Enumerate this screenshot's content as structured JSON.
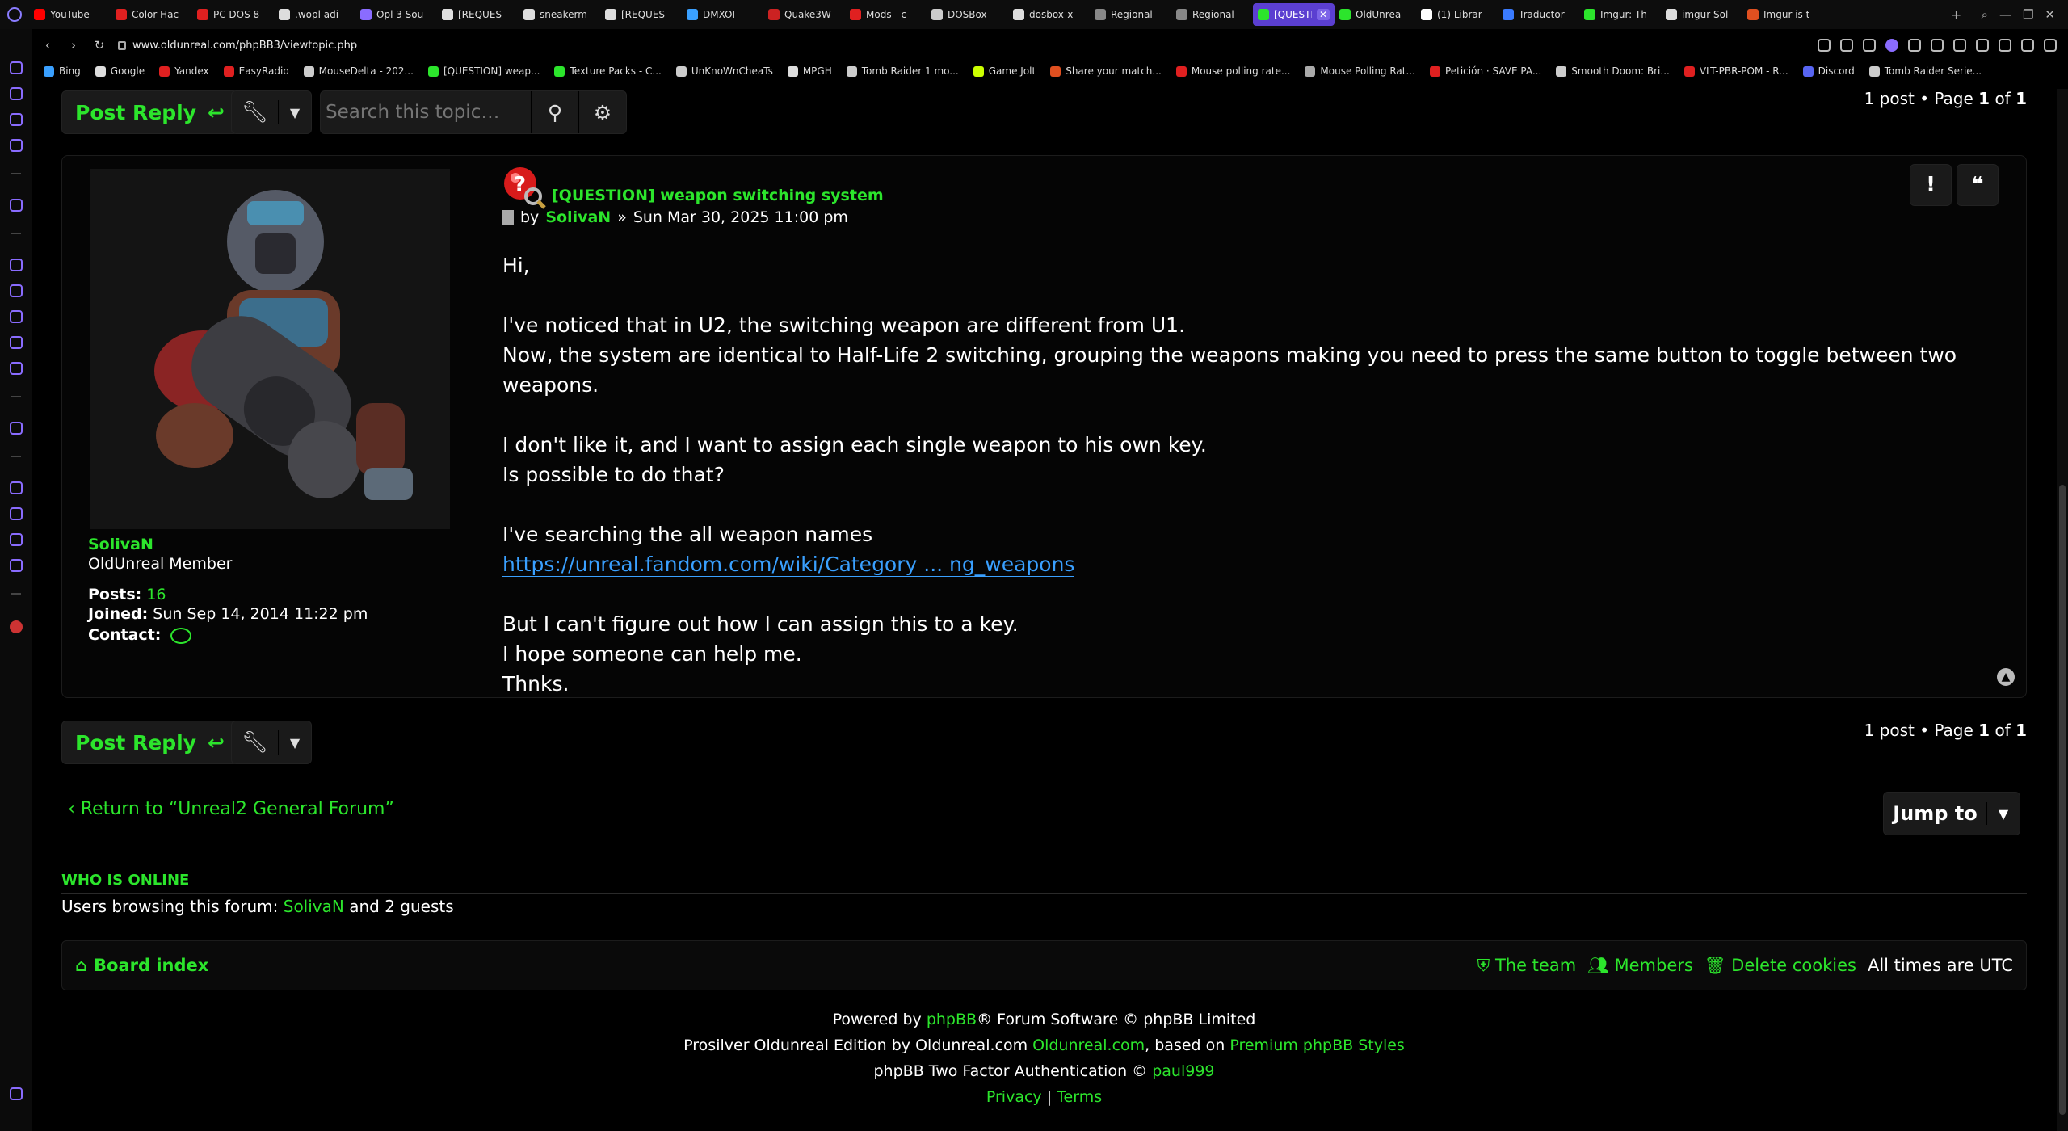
{
  "browser": {
    "url": "www.oldunreal.com/phpBB3/viewtopic.php",
    "tabs": [
      {
        "label": "YouTube",
        "color": "#ff0000"
      },
      {
        "label": "Color Hac",
        "color": "#e02020"
      },
      {
        "label": "PC DOS 8",
        "color": "#e02020"
      },
      {
        "label": ".wopl adi",
        "color": "#dddddd"
      },
      {
        "label": "Opl 3 Sou",
        "color": "#8a6cff"
      },
      {
        "label": "[REQUES",
        "color": "#dddddd"
      },
      {
        "label": "sneakerm",
        "color": "#dddddd"
      },
      {
        "label": "[REQUES",
        "color": "#dddddd"
      },
      {
        "label": "DMXOI",
        "color": "#3aa0ff"
      },
      {
        "label": "Quake3W",
        "color": "#cc2222"
      },
      {
        "label": "Mods - c",
        "color": "#e02020"
      },
      {
        "label": "DOSBox-",
        "color": "#cccccc"
      },
      {
        "label": "dosbox-x",
        "color": "#dddddd"
      },
      {
        "label": "Regional",
        "color": "#888888"
      },
      {
        "label": "Regional",
        "color": "#888888"
      },
      {
        "label": "[QUESTION]",
        "color": "#2ce52c"
      },
      {
        "label": "OldUnrea",
        "color": "#2ce52c"
      },
      {
        "label": "(1) Librar",
        "color": "#ffffff"
      },
      {
        "label": "Traductor",
        "color": "#3a7bff"
      },
      {
        "label": "Imgur: Th",
        "color": "#2ce52c"
      },
      {
        "label": "imgur Sol",
        "color": "#dddddd"
      },
      {
        "label": "Imgur is t",
        "color": "#e05020"
      }
    ],
    "bookmarks": [
      {
        "label": "Bing",
        "color": "#3aa0ff"
      },
      {
        "label": "Google",
        "color": "#dddddd"
      },
      {
        "label": "Yandex",
        "color": "#e02020"
      },
      {
        "label": "EasyRadio",
        "color": "#e02020"
      },
      {
        "label": "MouseDelta - 202...",
        "color": "#cccccc"
      },
      {
        "label": "[QUESTION] weap...",
        "color": "#2ce52c"
      },
      {
        "label": "Texture Packs - C...",
        "color": "#2ce52c"
      },
      {
        "label": "UnKnoWnCheaTs",
        "color": "#cccccc"
      },
      {
        "label": "MPGH",
        "color": "#dddddd"
      },
      {
        "label": "Tomb Raider 1 mo...",
        "color": "#cccccc"
      },
      {
        "label": "Game Jolt",
        "color": "#ccff00"
      },
      {
        "label": "Share your match...",
        "color": "#e05020"
      },
      {
        "label": "Mouse polling rate...",
        "color": "#e02020"
      },
      {
        "label": "Mouse Polling Rat...",
        "color": "#aaaaaa"
      },
      {
        "label": "Petición · SAVE PA...",
        "color": "#e02020"
      },
      {
        "label": "Smooth Doom: Bri...",
        "color": "#cccccc"
      },
      {
        "label": "VLT-PBR-POM - R...",
        "color": "#e02020"
      },
      {
        "label": "Discord",
        "color": "#5865f2"
      },
      {
        "label": "Tomb Raider Serie...",
        "color": "#cccccc"
      }
    ]
  },
  "toolbar": {
    "post_reply": "Post Reply",
    "search_placeholder": "Search this topic…",
    "pagination": {
      "count": "1 post",
      "sep": "•",
      "page_word": "Page",
      "current": "1",
      "of_word": "of",
      "total": "1"
    }
  },
  "post": {
    "author": {
      "name": "SolivaN",
      "rank": "OldUnreal Member",
      "posts_label": "Posts:",
      "posts_value": "16",
      "joined_label": "Joined:",
      "joined_value": "Sun Sep 14, 2014 11:22 pm",
      "contact_label": "Contact:"
    },
    "title": "[QUESTION] weapon switching system",
    "meta_by": "by",
    "meta_author": "SolivaN",
    "meta_sep": "»",
    "meta_date": "Sun Mar 30, 2025 11:00 pm",
    "report_label": "!",
    "lines": [
      "Hi,",
      "",
      "I've noticed that in U2, the switching weapon are different from U1.",
      "Now, the system are identical to Half-Life 2 switching, grouping the weapons making you need to press the same button to toggle between two weapons.",
      "",
      "I don't like it, and I want to assign each single weapon to his own key.",
      "Is possible to do that?",
      "",
      "I've searching the all weapon names"
    ],
    "link": "https://unreal.fandom.com/wiki/Category ... ng_weapons",
    "lines_after": [
      "",
      "But I can't figure out how I can assign this to a key.",
      "I hope someone can help me.",
      "Thnks."
    ]
  },
  "nav": {
    "return_link": "Return to “Unreal2 General Forum”",
    "jump_to": "Jump to"
  },
  "online": {
    "heading": "WHO IS ONLINE",
    "prefix": "Users browsing this forum:",
    "user": "SolivaN",
    "suffix": "and 2 guests"
  },
  "footer": {
    "board_index": "Board index",
    "team": "The team",
    "members": "Members",
    "delete_cookies": "Delete cookies",
    "timezone": "All times are UTC",
    "powered_pre": "Powered by",
    "powered_link": "phpBB",
    "powered_post": "® Forum Software © phpBB Limited",
    "edition_pre": "Prosilver Oldunreal Edition by Oldunreal.com",
    "edition_link": "Oldunreal.com",
    "edition_mid": ", based on",
    "edition_link2": "Premium phpBB Styles",
    "twofa_pre": "phpBB Two Factor Authentication ©",
    "twofa_link": "paul999",
    "privacy": "Privacy",
    "divider": "|",
    "terms": "Terms"
  },
  "colors": {
    "accent": "#2ce52c",
    "link": "#3aa0ff",
    "tab_active": "#5b3fd1"
  }
}
